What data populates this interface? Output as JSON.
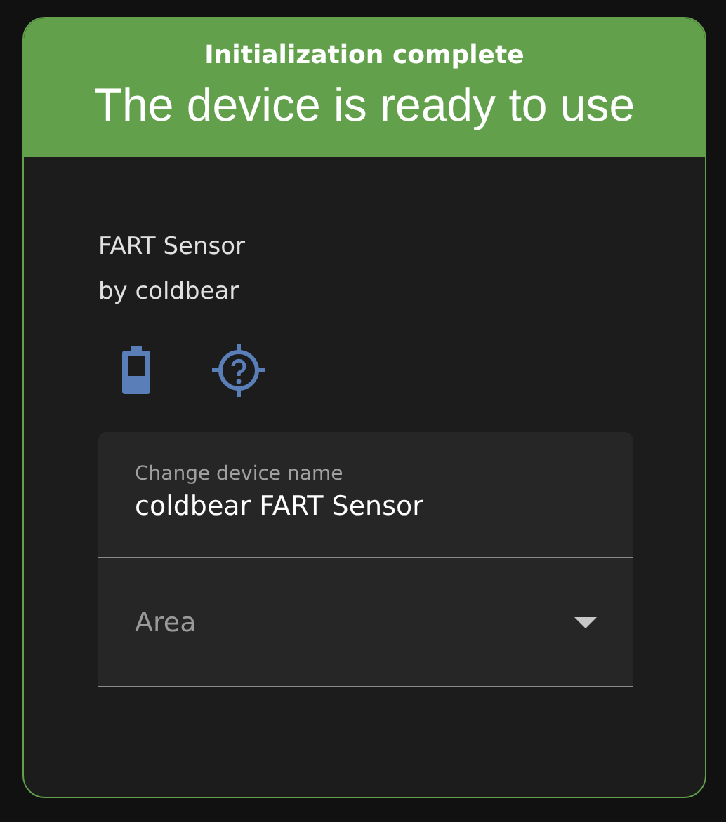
{
  "header": {
    "subtitle": "Initialization complete",
    "title": "The device is ready to use"
  },
  "device": {
    "name": "FART Sensor",
    "manufacturer": "by coldbear"
  },
  "name_field": {
    "label": "Change device name",
    "value": "coldbear FART Sensor"
  },
  "area_field": {
    "placeholder": "Area"
  }
}
